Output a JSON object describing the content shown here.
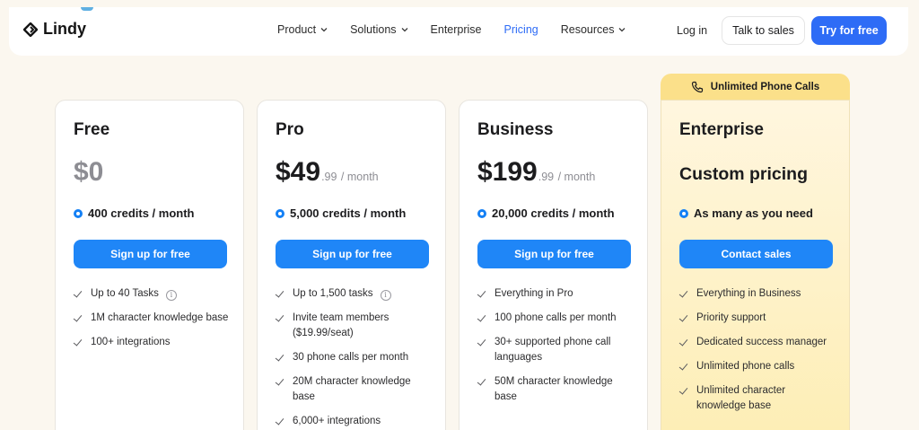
{
  "nav": {
    "brand": "Lindy",
    "menu": [
      {
        "label": "Product",
        "has_dropdown": true
      },
      {
        "label": "Solutions",
        "has_dropdown": true
      },
      {
        "label": "Enterprise",
        "has_dropdown": false
      },
      {
        "label": "Pricing",
        "has_dropdown": false,
        "active": true
      },
      {
        "label": "Resources",
        "has_dropdown": true
      }
    ],
    "login": "Log in",
    "talk_to_sales": "Talk to sales",
    "try_free": "Try for free"
  },
  "colors": {
    "accent": "#2e6cf6",
    "button_blue": "#1f86f7",
    "active_link": "#2e6cf6",
    "ribbon": "#fbe08a",
    "background": "#fbf7ef"
  },
  "ribbon": {
    "icon": "phone-icon",
    "label": "Unlimited Phone Calls"
  },
  "plans": [
    {
      "name": "Free",
      "price": "$0",
      "cents": "",
      "period": "",
      "credits": "400 credits / month",
      "button": "Sign up for free",
      "features": [
        "Up to 40 Tasks",
        "1M character knowledge base",
        "100+ integrations"
      ]
    },
    {
      "name": "Pro",
      "price": "$49",
      "cents": ".99",
      "period": " / month",
      "credits": "5,000 credits / month",
      "button": "Sign up for free",
      "features": [
        "Up to 1,500 tasks",
        "Invite team members ($19.99/seat)",
        "30 phone calls per month",
        "20M character knowledge base",
        "6,000+ integrations"
      ]
    },
    {
      "name": "Business",
      "price": "$199",
      "cents": ".99",
      "period": " / month",
      "credits": "20,000 credits / month",
      "button": "Sign up for free",
      "features": [
        "Everything in Pro",
        "100 phone calls per month",
        "30+ supported phone call languages",
        "50M character knowledge base"
      ]
    },
    {
      "name": "Enterprise",
      "price": "Custom pricing",
      "credits": "As many as you need",
      "button": "Contact sales",
      "features": [
        "Everything in Business",
        "Priority support",
        "Dedicated success manager",
        "Unlimited phone calls",
        "Unlimited character knowledge base"
      ]
    }
  ]
}
